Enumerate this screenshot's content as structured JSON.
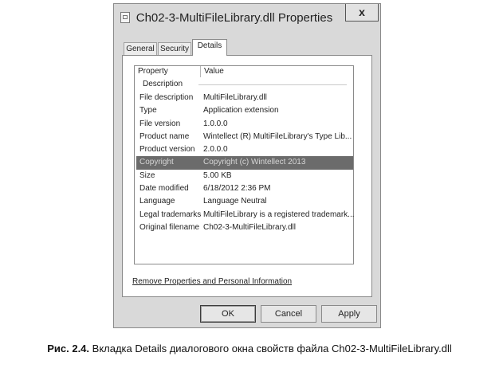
{
  "window": {
    "title": "Ch02-3-MultiFileLibrary.dll Properties",
    "close_label": "x"
  },
  "tabs": [
    {
      "label": "General"
    },
    {
      "label": "Security"
    },
    {
      "label": "Details"
    }
  ],
  "list": {
    "columns": {
      "property": "Property",
      "value": "Value"
    },
    "group": "Description",
    "rows": [
      {
        "name": "File description",
        "value": "MultiFileLibrary.dll"
      },
      {
        "name": "Type",
        "value": "Application extension"
      },
      {
        "name": "File version",
        "value": "1.0.0.0"
      },
      {
        "name": "Product name",
        "value": "Wintellect (R) MultiFileLibrary's Type Lib..."
      },
      {
        "name": "Product version",
        "value": "2.0.0.0"
      },
      {
        "name": "Copyright",
        "value": "Copyright (c) Wintellect 2013"
      },
      {
        "name": "Size",
        "value": "5.00 KB"
      },
      {
        "name": "Date modified",
        "value": "6/18/2012 2:36 PM"
      },
      {
        "name": "Language",
        "value": "Language Neutral"
      },
      {
        "name": "Legal trademarks",
        "value": "MultiFileLibrary is a registered trademark..."
      },
      {
        "name": "Original filename",
        "value": "Ch02-3-MultiFileLibrary.dll"
      }
    ],
    "selected_row": "Copyright"
  },
  "remove_link": "Remove Properties and Personal Information",
  "buttons": {
    "ok": "OK",
    "cancel": "Cancel",
    "apply": "Apply"
  },
  "caption": {
    "label": "Рис. 2.4.",
    "text": " Вкладка Details диалогового окна свойств файла Ch02-3-MultiFileLibrary.dll"
  }
}
